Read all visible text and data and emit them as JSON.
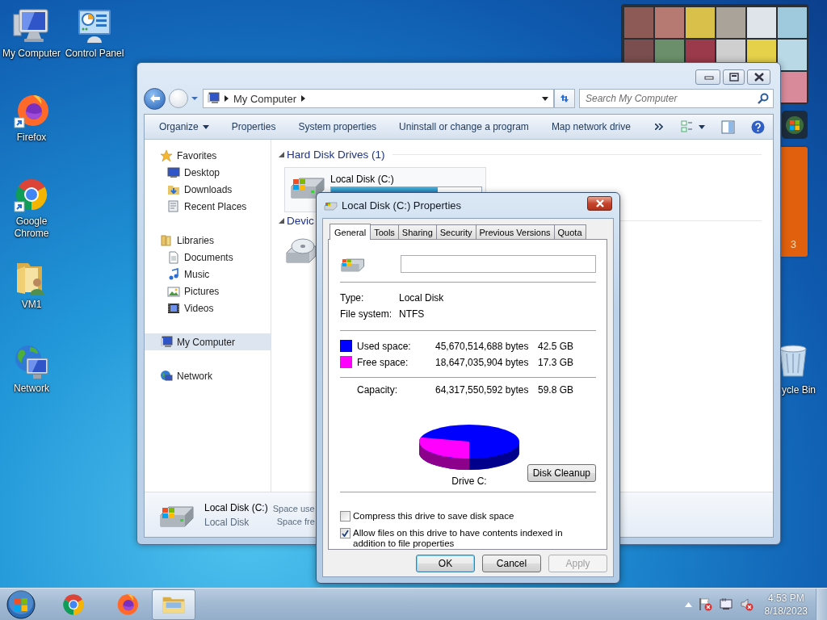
{
  "desktop_icons": [
    {
      "label": "My Computer"
    },
    {
      "label": "Control Panel"
    },
    {
      "label": "Firefox"
    },
    {
      "label": "Google Chrome"
    },
    {
      "label": "VM1"
    },
    {
      "label": "Network"
    }
  ],
  "recycle_bin": {
    "label": "ycle Bin"
  },
  "calendar_gadget": {
    "text": "3"
  },
  "explorer": {
    "address": "My Computer",
    "search": {
      "placeholder": "Search My Computer"
    },
    "toolbar": [
      {
        "label": "Organize",
        "kind": "menu"
      },
      {
        "label": "Properties",
        "kind": "command"
      },
      {
        "label": "System properties",
        "kind": "command"
      },
      {
        "label": "Uninstall or change a program",
        "kind": "command"
      },
      {
        "label": "Map network drive",
        "kind": "command"
      }
    ],
    "nav": [
      {
        "label": "Favorites",
        "selected": false,
        "children": [
          {
            "label": "Desktop",
            "selected": false
          },
          {
            "label": "Downloads",
            "selected": false
          },
          {
            "label": "Recent Places",
            "selected": false
          }
        ]
      },
      {
        "label": "Libraries",
        "selected": false,
        "children": [
          {
            "label": "Documents",
            "selected": false
          },
          {
            "label": "Music",
            "selected": false
          },
          {
            "label": "Pictures",
            "selected": false
          },
          {
            "label": "Videos",
            "selected": false
          }
        ]
      },
      {
        "label": "My Computer",
        "selected": true
      },
      {
        "label": "Network",
        "selected": false
      }
    ],
    "sections": [
      {
        "title": "Hard Disk Drives (1)"
      },
      {
        "title": "Devic"
      }
    ],
    "drive_tile": {
      "name": "Local Disk (C:)",
      "level": 0.71
    },
    "details": {
      "name": "Local Disk (C:)",
      "type": "Local Disk",
      "fields": [
        "Space use",
        "Space fre"
      ]
    }
  },
  "dialog": {
    "title": "Local Disk (C:) Properties",
    "tabs": [
      {
        "label": "General",
        "selected": true
      },
      {
        "label": "Tools",
        "selected": false
      },
      {
        "label": "Sharing",
        "selected": false
      },
      {
        "label": "Security",
        "selected": false
      },
      {
        "label": "Previous Versions",
        "selected": false
      },
      {
        "label": "Quota",
        "selected": false
      }
    ],
    "info": [
      {
        "label": "Type:",
        "value": "Local Disk"
      },
      {
        "label": "File system:",
        "value": "NTFS"
      }
    ],
    "space": [
      {
        "label": "Used space:",
        "bytes": "45,670,514,688 bytes",
        "size": "42.5 GB",
        "color": "#0000ff"
      },
      {
        "label": "Free space:",
        "bytes": "18,647,035,904 bytes",
        "size": "17.3 GB",
        "color": "#ff00ff"
      }
    ],
    "capacity": {
      "label": "Capacity:",
      "bytes": "64,317,550,592 bytes",
      "size": "59.8 GB"
    },
    "drive_label": "Drive C:",
    "cleanup_button": "Disk Cleanup",
    "options": [
      {
        "label": "Compress this drive to save disk space",
        "checked": false
      },
      {
        "label": "Allow files on this drive to have contents indexed in addition to file properties",
        "checked": true
      }
    ],
    "buttons": [
      {
        "label": "OK",
        "default": true,
        "disabled": false
      },
      {
        "label": "Cancel",
        "default": false,
        "disabled": false
      },
      {
        "label": "Apply",
        "default": false,
        "disabled": true
      }
    ]
  },
  "taskbar": {
    "apps": [
      {
        "selected": false
      },
      {
        "selected": false
      },
      {
        "selected": true
      }
    ],
    "time": "4:53 PM",
    "date": "8/18/2023"
  }
}
